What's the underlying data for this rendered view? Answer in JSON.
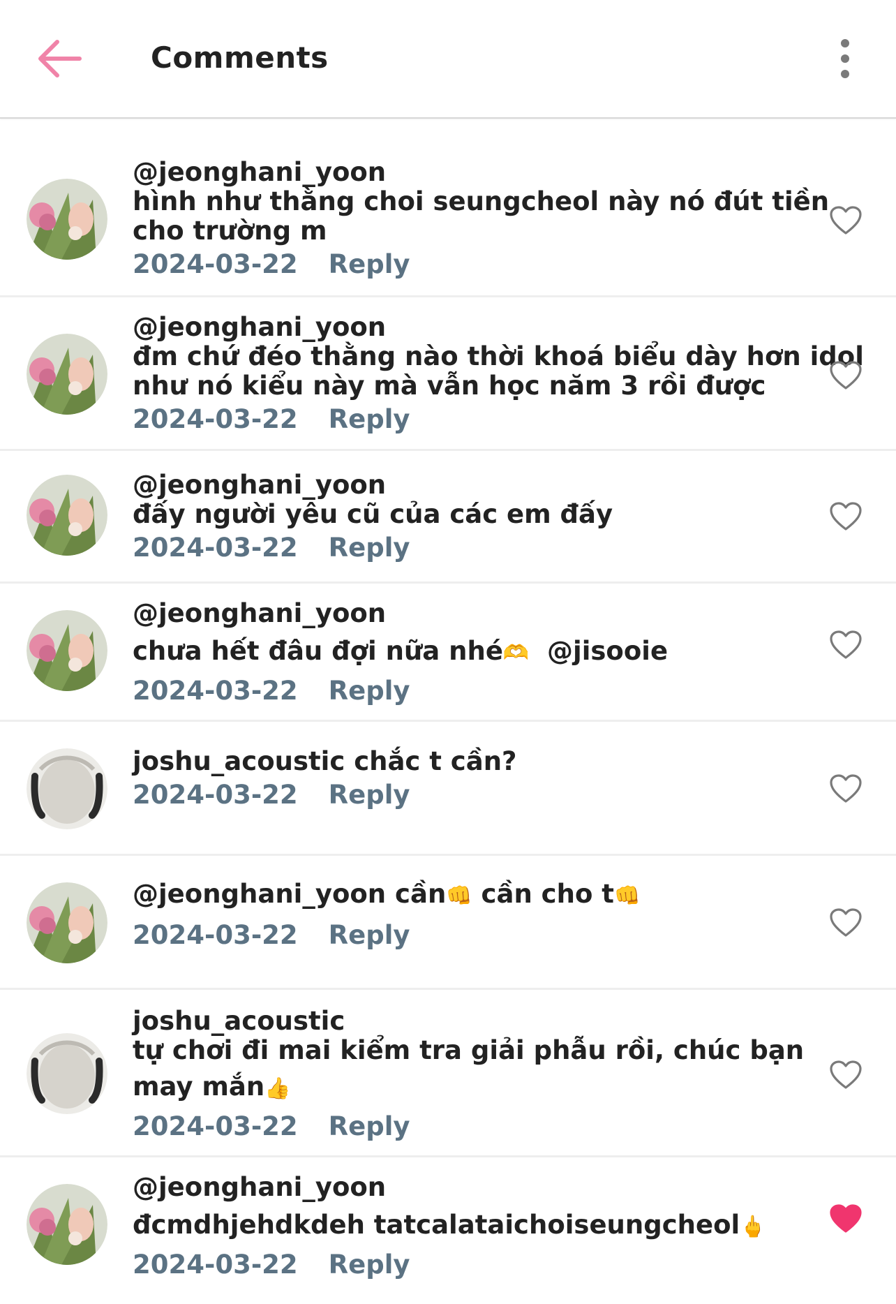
{
  "header": {
    "title": "Comments"
  },
  "comments": [
    {
      "user": "@jeonghani_yoon",
      "line1": "hình như thằng choi seungcheol này nó đút tiền",
      "line2": "cho trường m",
      "date": "2024-03-22",
      "reply": "Reply",
      "liked": false
    },
    {
      "user": "@jeonghani_yoon",
      "line1": "đm chứ đéo thằng nào thời khoá biểu dày hơn idol",
      "line2": "như nó kiểu này mà vẫn học năm 3 rồi được",
      "date": "2024-03-22",
      "reply": "Reply",
      "liked": false
    },
    {
      "user": "@jeonghani_yoon",
      "line1": "đấy người yêu cũ của các em đấy",
      "date": "2024-03-22",
      "reply": "Reply",
      "liked": false
    },
    {
      "user": "@jeonghani_yoon",
      "text": "chưa hết đâu đợi nữa nhé",
      "emoji": "🫶",
      "mention": "@jisooie",
      "date": "2024-03-22",
      "reply": "Reply",
      "liked": false
    },
    {
      "user": "joshu_acoustic",
      "text": "chắc t cần?",
      "date": "2024-03-22",
      "reply": "Reply",
      "liked": false
    },
    {
      "user": "@jeonghani_yoon",
      "text": "cần",
      "emoji": "👊",
      "text2": "cần cho t",
      "emoji2": "👊",
      "date": "2024-03-22",
      "reply": "Reply",
      "liked": false
    },
    {
      "user": "joshu_acoustic",
      "line1": "tự chơi đi mai kiểm tra giải phẫu rồi, chúc bạn",
      "line2": "may mắn",
      "emoji": "👍",
      "date": "2024-03-22",
      "reply": "Reply",
      "liked": false
    },
    {
      "user": "@jeonghani_yoon",
      "text": "đcmdhjehdkdeh tatcalataichoiseungcheol",
      "emoji": "🖕",
      "date": "2024-03-22",
      "reply": "Reply",
      "liked": true
    }
  ],
  "colors": {
    "accent": "#f083a8",
    "heart_active": "#f0356e",
    "meta": "#5b7283",
    "icon": "#7a7a7a"
  }
}
